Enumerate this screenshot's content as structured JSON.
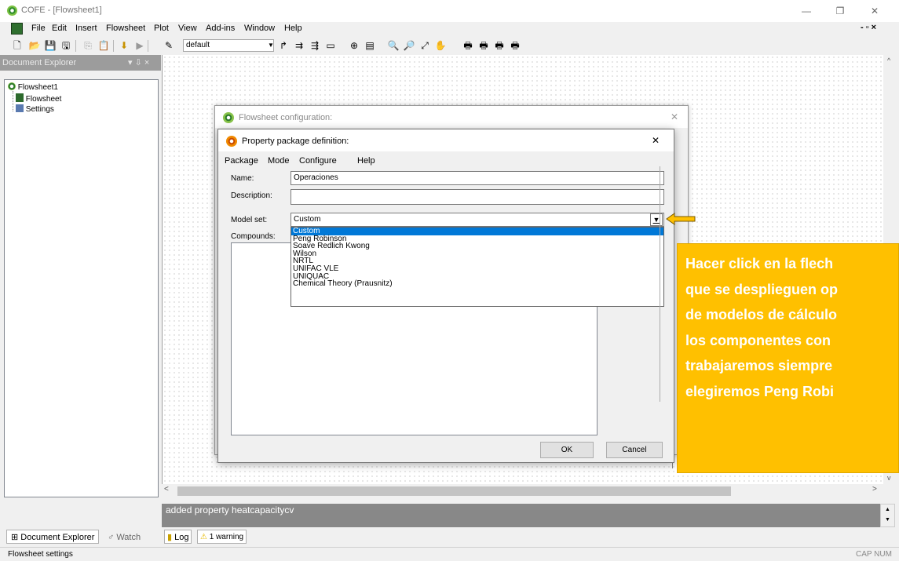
{
  "window": {
    "title": "COFE - [Flowsheet1]",
    "minimize": "—",
    "restore": "❐",
    "close": "✕"
  },
  "menu": [
    "File",
    "Edit",
    "Insert",
    "Flowsheet",
    "Plot",
    "View",
    "Add-ins",
    "Window",
    "Help"
  ],
  "mdi_controls": "- ▫ ×",
  "toolbar": {
    "combo_value": "default"
  },
  "explorer": {
    "title": "Document Explorer",
    "pin_controls": "▾ ⇩ ×",
    "tree": {
      "root": "Flowsheet1",
      "children": [
        "Flowsheet",
        "Settings"
      ]
    }
  },
  "dialog_back": {
    "title": "Flowsheet configuration:",
    "close": "✕"
  },
  "dialog": {
    "title": "Property package definition:",
    "close": "✕",
    "menu": [
      "Package",
      "Mode",
      "Configure",
      "Help"
    ],
    "name_label": "Name:",
    "name_value": "Operaciones",
    "description_label": "Description:",
    "description_value": "",
    "model_set_label": "Model set:",
    "model_set_value": "Custom",
    "compounds_label": "Compounds:",
    "model_options": [
      "Custom",
      "Peng Robinson",
      "Soave Redlich Kwong",
      "Wilson",
      "NRTL",
      "UNIFAC VLE",
      "UNIQUAC",
      "Chemical Theory (Prausnitz)"
    ],
    "selected_option": "Custom",
    "ok": "OK",
    "cancel": "Cancel"
  },
  "callout": {
    "lines": [
      "Hacer click en la flech",
      "que se desplieguen op",
      "de modelos de cálculo",
      "los componentes con",
      "trabajaremos siempre",
      "elegiremos Peng Robi"
    ],
    "color": "#ffc000"
  },
  "log": {
    "text": "added property heatcapacitycv"
  },
  "bottom_tabs": {
    "explorer": "Document Explorer",
    "watch": "Watch",
    "log": "Log",
    "warning": "1 warning"
  },
  "status": {
    "left": "Flowsheet settings",
    "right": "CAP NUM"
  }
}
